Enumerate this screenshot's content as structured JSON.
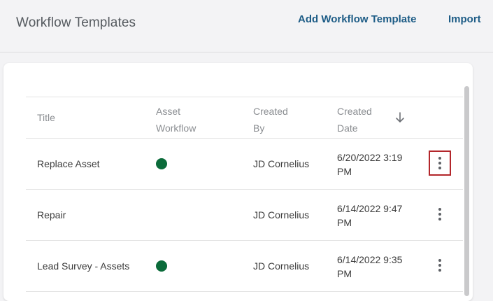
{
  "header": {
    "title": "Workflow Templates",
    "add_label": "Add Workflow Template",
    "import_label": "Import"
  },
  "table": {
    "columns": {
      "title": "Title",
      "asset_line1": "Asset",
      "asset_line2": "Workflow",
      "by_line1": "Created",
      "by_line2": "By",
      "date_line1": "Created",
      "date_line2": "Date"
    },
    "rows": [
      {
        "title": "Replace Asset",
        "asset_workflow": true,
        "created_by": "JD Cornelius",
        "date_line1": "6/20/2022 3:19",
        "date_line2": "PM",
        "menu_selected": true
      },
      {
        "title": "Repair",
        "asset_workflow": false,
        "created_by": "JD Cornelius",
        "date_line1": "6/14/2022 9:47",
        "date_line2": "PM",
        "menu_selected": false
      },
      {
        "title": "Lead Survey - Assets",
        "asset_workflow": true,
        "created_by": "JD Cornelius",
        "date_line1": "6/14/2022 9:35",
        "date_line2": "PM",
        "menu_selected": false
      }
    ]
  },
  "icons": {
    "sort": "arrow-down-icon",
    "row_menu": "more-vertical-icon"
  },
  "colors": {
    "link": "#1d5c86",
    "asset_dot": "#0b6b3a",
    "selected_outline": "#b3262b"
  }
}
